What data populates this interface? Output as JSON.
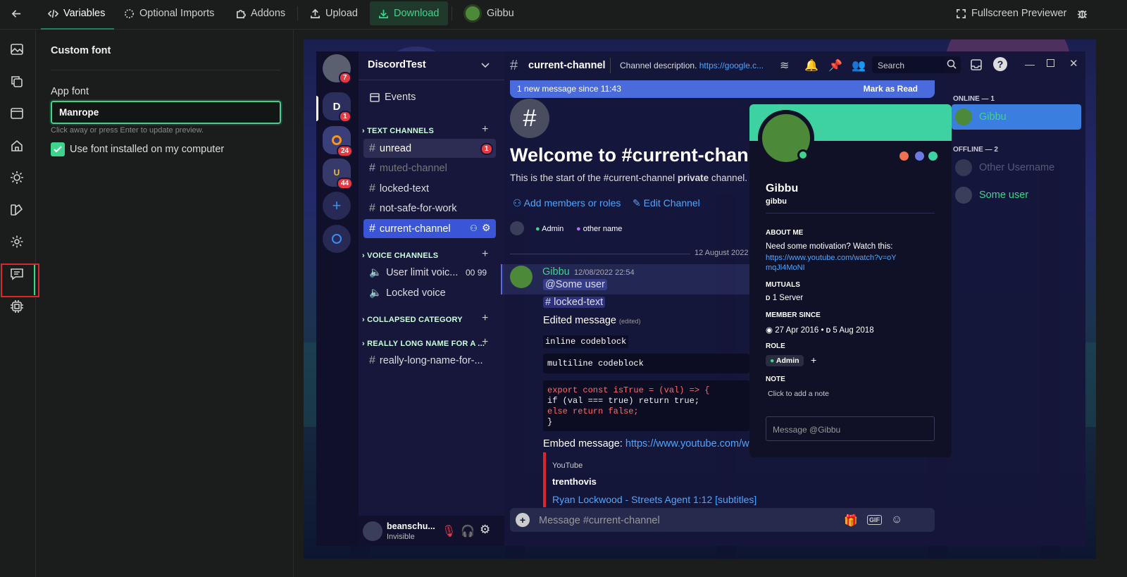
{
  "toolbar": {
    "back": "back-icon",
    "tabs": [
      "Variables",
      "Optional Imports",
      "Addons"
    ],
    "upload": "Upload",
    "download": "Download",
    "user": "Gibbu",
    "fullscreen": "Fullscreen Previewer"
  },
  "panel": {
    "title": "Custom font",
    "field_label": "App font",
    "field_value": "Manrope",
    "hint": "Click away or press Enter to update preview.",
    "checkbox_label": "Use font installed on my computer",
    "checkbox_checked": true
  },
  "discord": {
    "server_name": "DiscordTest",
    "guild_badges": [
      "7",
      "1",
      "24",
      "44"
    ],
    "guild_letter": "D",
    "events": "Events",
    "text_category": "TEXT CHANNELS",
    "text_channels": [
      "unread",
      "muted-channel",
      "locked-text",
      "not-safe-for-work",
      "current-channel"
    ],
    "unread_badge": "1",
    "voice_category": "VOICE CHANNELS",
    "voice_channels": [
      "User limit voic...",
      "Locked voice"
    ],
    "voice_limit": "00",
    "voice_limit_max": "99",
    "collapsed_category": "COLLAPSED CATEGORY",
    "long_category": "REALLY LONG NAME FOR A ...",
    "long_channel": "really-long-name-for-...",
    "user_name": "beanschu...",
    "user_status": "Invisible",
    "header_channel": "current-channel",
    "header_desc": "Channel description.",
    "header_link": "https://google.c...",
    "search": "Search",
    "new_message_bar": "1 new message since 11:43",
    "mark_read": "Mark as Read",
    "welcome": "Welcome to #current-chann",
    "start_text_1": "This is the start of the #current-channel ",
    "start_text_bold": "private",
    "start_text_2": " channel.",
    "add_members": "Add members or roles",
    "edit_channel": "Edit Channel",
    "role_admin": "Admin",
    "role_other": "other name",
    "date_divider": "12 August 2022",
    "msg_author": "Gibbu",
    "msg_time": "12/08/2022 22:54",
    "mention": "@Some user",
    "channel_mention": "# locked-text",
    "edited_msg": "Edited message",
    "edited_tag": "(edited)",
    "inline_code": "inline codeblock",
    "multiline_code": "multiline codeblock",
    "code_lines": [
      "export const isTrue = (val) => {",
      "if (val === true) return true;",
      "else return false;",
      "}"
    ],
    "embed_label": "Embed message: ",
    "embed_link": "https://www.youtube.com/wa",
    "embed_provider": "YouTube",
    "embed_author": "trenthovis",
    "embed_title": "Ryan Lockwood - Streets Agent 1:12 [subtitles]",
    "input_placeholder": "Message #current-channel",
    "gif": "GIF",
    "profile": {
      "name": "Gibbu",
      "username": "gibbu",
      "about_heading": "ABOUT ME",
      "about": "Need some motivation? Watch this:",
      "about_link": "https://www.youtube.com/watch?v=oYmqJl4MoNI",
      "mutuals_heading": "MUTUALS",
      "mutuals": "1 Server",
      "member_since_heading": "MEMBER SINCE",
      "since_discord": "27 Apr 2016",
      "since_server": "5 Aug 2018",
      "role_heading": "ROLE",
      "role": "Admin",
      "note_heading": "NOTE",
      "note": "Click to add a note",
      "message_placeholder": "Message @Gibbu"
    },
    "online_heading": "ONLINE — 1",
    "online_member": "Gibbu",
    "offline_heading": "OFFLINE — 2",
    "offline_members": [
      "Other Username",
      "Some user"
    ]
  },
  "colors": {
    "accent": "#3ed48c",
    "selection": "#e0242a",
    "blurple": "#3a56d6"
  }
}
